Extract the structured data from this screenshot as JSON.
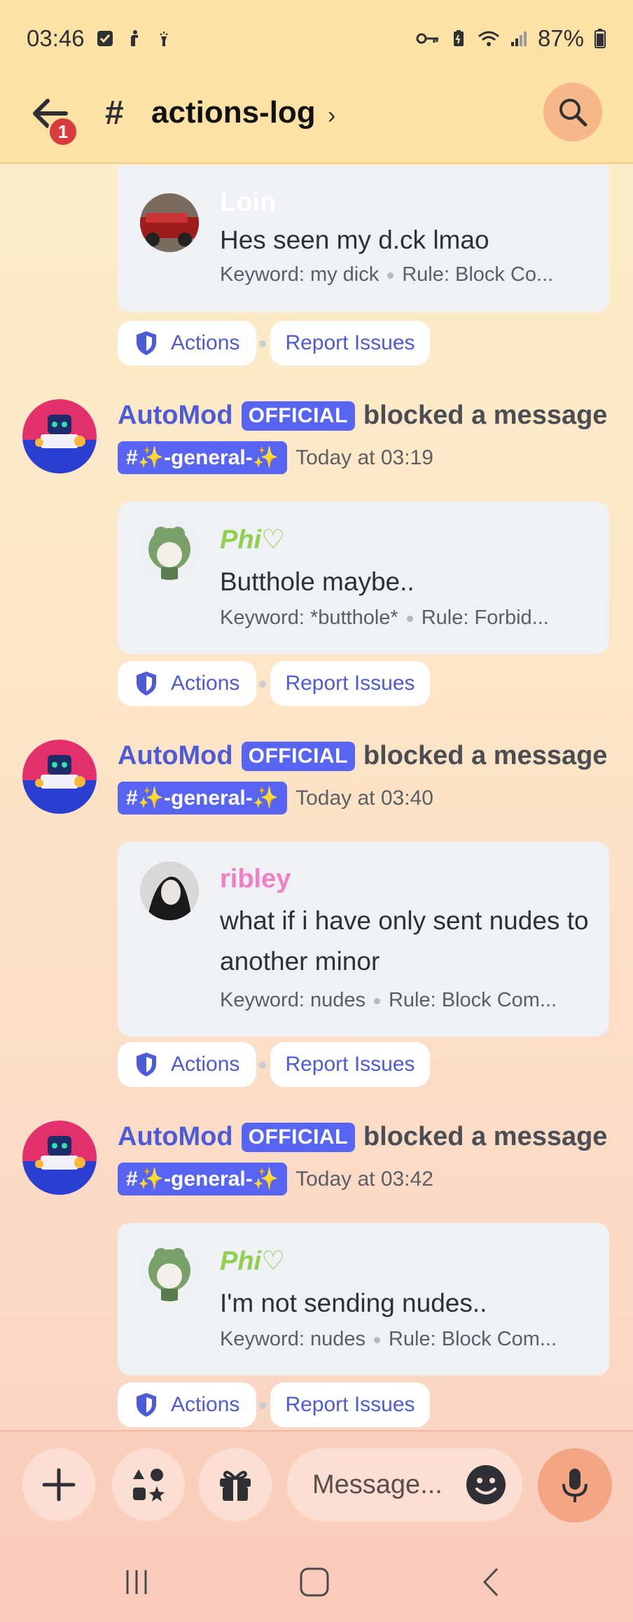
{
  "status_bar": {
    "time": "03:46",
    "battery": "87%"
  },
  "header": {
    "notification_count": "1",
    "channel_hash": "#",
    "channel_name": "actions-log",
    "chevron": "›"
  },
  "log_entries": [
    {
      "user": "Loin",
      "message": "Hes seen my d.ck lmao",
      "keyword": "Keyword: my dick",
      "rule": "Rule: Block Co...",
      "actions_label": "Actions",
      "report_label": "Report Issues"
    },
    {
      "bot_name": "AutoMod",
      "official_label": "OFFICIAL",
      "action_text": "blocked a message",
      "channel_tag": "#✨-general-✨",
      "time": "Today at 03:19",
      "user": "Phi♡",
      "message": "Butthole maybe..",
      "keyword": "Keyword: *butthole*",
      "rule": "Rule: Forbid...",
      "actions_label": "Actions",
      "report_label": "Report Issues"
    },
    {
      "bot_name": "AutoMod",
      "official_label": "OFFICIAL",
      "action_text": "blocked a message",
      "channel_tag": "#✨-general-✨",
      "time": "Today at 03:40",
      "user": "ribley",
      "message": "what if i have only sent nudes to another minor",
      "keyword": "Keyword: nudes",
      "rule": "Rule: Block Com...",
      "actions_label": "Actions",
      "report_label": "Report Issues"
    },
    {
      "bot_name": "AutoMod",
      "official_label": "OFFICIAL",
      "action_text": "blocked a message",
      "channel_tag": "#✨-general-✨",
      "time": "Today at 03:42",
      "user": "Phi♡",
      "message": "I'm not sending nudes..",
      "keyword": "Keyword: nudes",
      "rule": "Rule: Block Com...",
      "actions_label": "Actions",
      "report_label": "Report Issues"
    }
  ],
  "composer": {
    "placeholder": "Message...",
    "icons": [
      "plus-icon",
      "apps-icon",
      "gift-icon",
      "emoji-icon",
      "microphone-icon"
    ]
  },
  "colors": {
    "accent": "#5865f2",
    "link": "#4e5bd6",
    "header_bg": "#fde2a6",
    "badge": "#d83c3e",
    "green_name": "#8fd14f",
    "pink_name": "#f07fc6"
  }
}
